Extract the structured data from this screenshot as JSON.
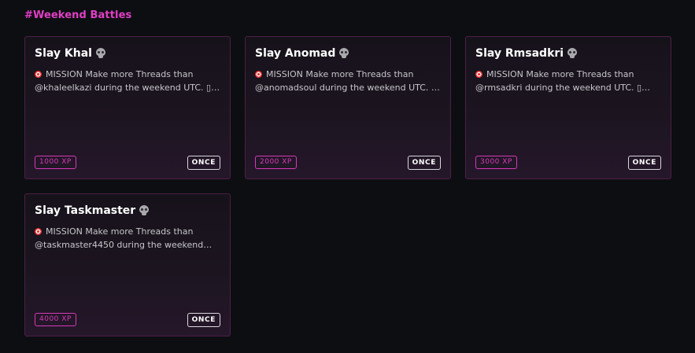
{
  "section": {
    "title": "#Weekend Battles"
  },
  "cards": [
    {
      "title": "Slay Khal",
      "icon": "skull-icon",
      "desc_line1": "MISSION Make more Threads than",
      "desc_line2": "@khaleelkazi during the weekend UTC. ▯…",
      "xp": "1000 XP",
      "frequency": "ONCE"
    },
    {
      "title": "Slay Anomad",
      "icon": "skull-icon",
      "desc_line1": "MISSION Make more Threads than",
      "desc_line2": "@anomadsoul during the weekend UTC. …",
      "xp": "2000 XP",
      "frequency": "ONCE"
    },
    {
      "title": "Slay Rmsadkri",
      "icon": "skull-icon",
      "desc_line1": "MISSION Make more Threads than",
      "desc_line2": "@rmsadkri during the weekend UTC. ▯…",
      "xp": "3000 XP",
      "frequency": "ONCE"
    },
    {
      "title": "Slay Taskmaster",
      "icon": "skull-icon",
      "desc_line1": "MISSION Make more Threads than",
      "desc_line2": "@taskmaster4450 during the weekend…",
      "xp": "4000 XP",
      "frequency": "ONCE"
    }
  ],
  "colors": {
    "accent": "#e23fc6",
    "background": "#0d0e12",
    "card_border": "#4c2045"
  }
}
